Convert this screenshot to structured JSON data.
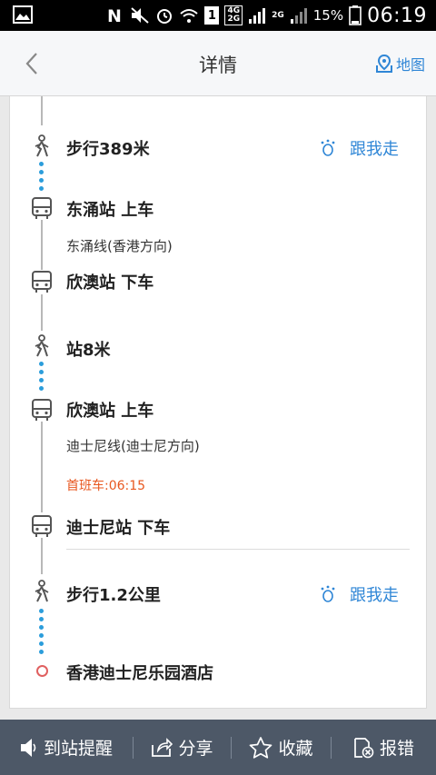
{
  "status_bar": {
    "network": "4G\n2G",
    "network_top": "4G",
    "network_bottom": "2G",
    "sim_slot": "1",
    "secondary_network": "2G",
    "battery_percent": "15%",
    "time": "06:19"
  },
  "header": {
    "title": "详情",
    "map_label": "地图",
    "accent_color": "#2f86d6"
  },
  "route": {
    "steps": [
      {
        "type": "walk",
        "text": "步行389米",
        "follow_label": "跟我走"
      },
      {
        "type": "bus",
        "text": "东涌站 上车",
        "line": "东涌线(香港方向)"
      },
      {
        "type": "bus",
        "text": "欣澳站 下车"
      },
      {
        "type": "walk",
        "text": "站8米"
      },
      {
        "type": "bus",
        "text": "欣澳站 上车",
        "line": "迪士尼线(迪士尼方向)",
        "first_bus": "首班车:06:15"
      },
      {
        "type": "bus",
        "text": "迪士尼站 下车"
      },
      {
        "type": "walk",
        "text": "步行1.2公里",
        "follow_label": "跟我走"
      },
      {
        "type": "destination",
        "text": "香港迪士尼乐园酒店"
      }
    ],
    "first_bus_color": "#e8571f",
    "walk_dot_color": "#2b9ddb"
  },
  "toolbar": {
    "items": [
      {
        "label": "到站提醒",
        "icon": "speaker-icon"
      },
      {
        "label": "分享",
        "icon": "share-icon"
      },
      {
        "label": "收藏",
        "icon": "star-icon"
      },
      {
        "label": "报错",
        "icon": "report-error-icon"
      }
    ],
    "background": "#4d5867"
  }
}
